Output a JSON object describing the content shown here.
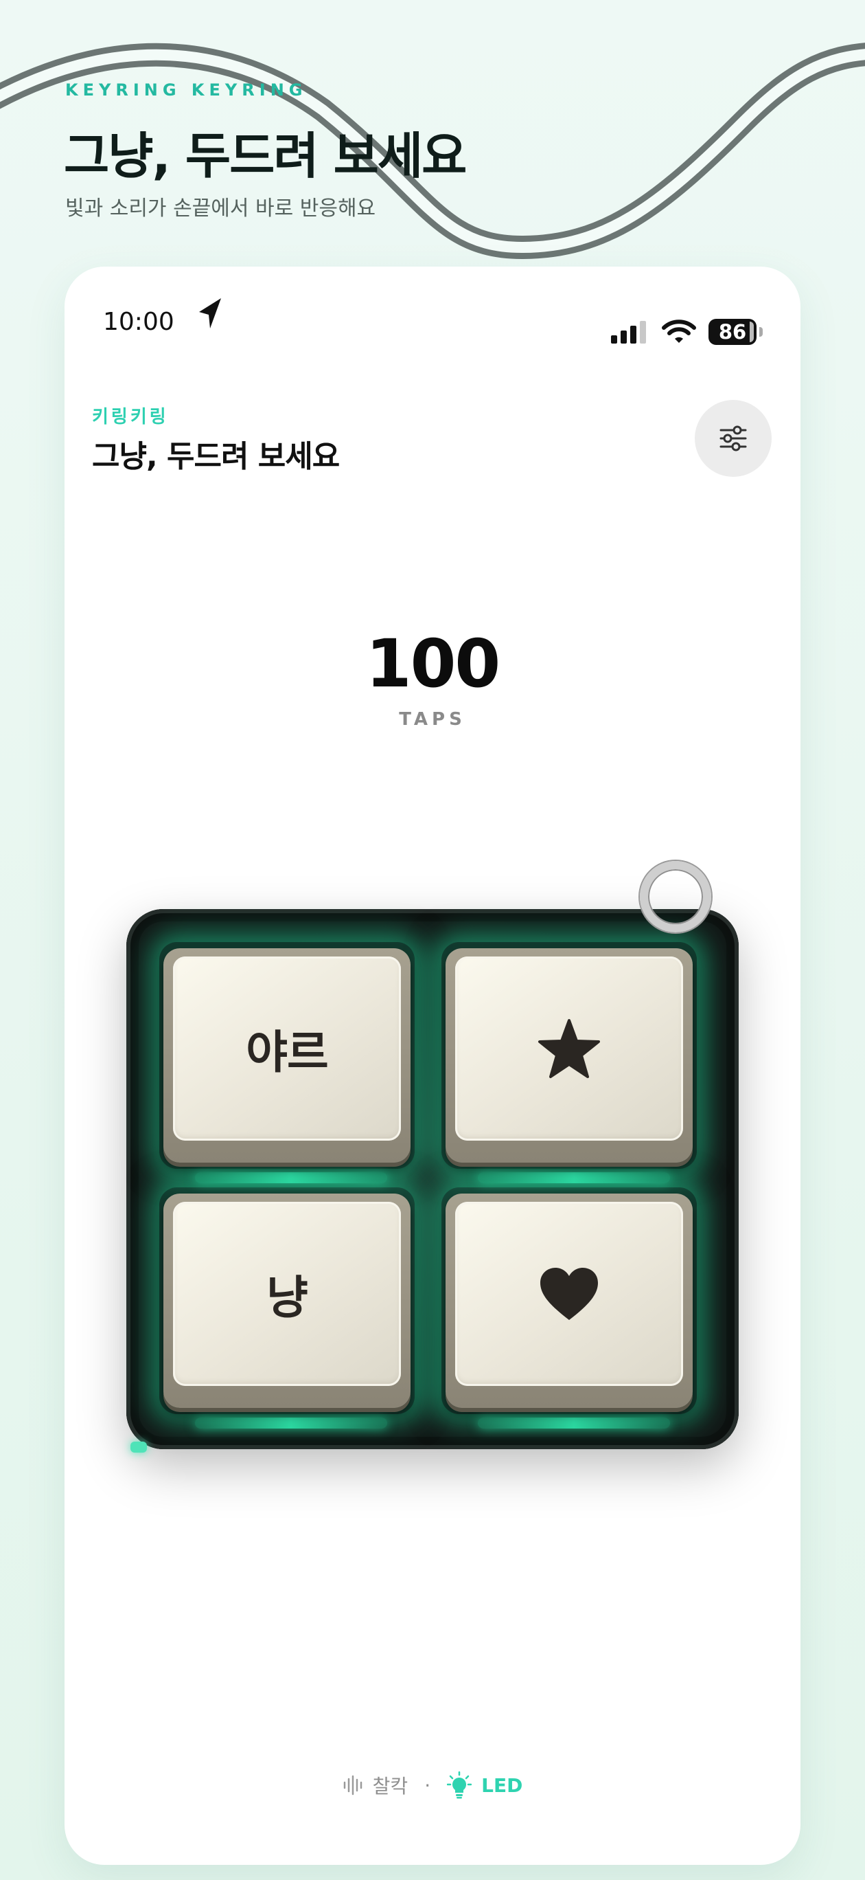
{
  "hero": {
    "kicker": "KEYRING KEYRING",
    "title": "그냥, 두드려 보세요",
    "subtitle": "빛과 소리가 손끝에서 바로 반응해요"
  },
  "status_bar": {
    "time": "10:00",
    "battery": "86",
    "icons": [
      "location-arrow-icon",
      "signal-icon",
      "wifi-icon",
      "battery-icon"
    ]
  },
  "app": {
    "kicker": "키링키링",
    "title": "그냥, 두드려 보세요",
    "settings_icon": "sliders-icon"
  },
  "counter": {
    "value": "100",
    "label": "TAPS"
  },
  "keypad": {
    "keys": [
      {
        "label": "야르",
        "type": "text"
      },
      {
        "label": "",
        "type": "star-icon"
      },
      {
        "label": "냥",
        "type": "text"
      },
      {
        "label": "",
        "type": "heart-icon"
      }
    ],
    "glow_color": "#23d49c"
  },
  "footer": {
    "sound_label": "찰칵",
    "separator": "·",
    "led_label": "LED",
    "accent": "#2fd3b0"
  }
}
